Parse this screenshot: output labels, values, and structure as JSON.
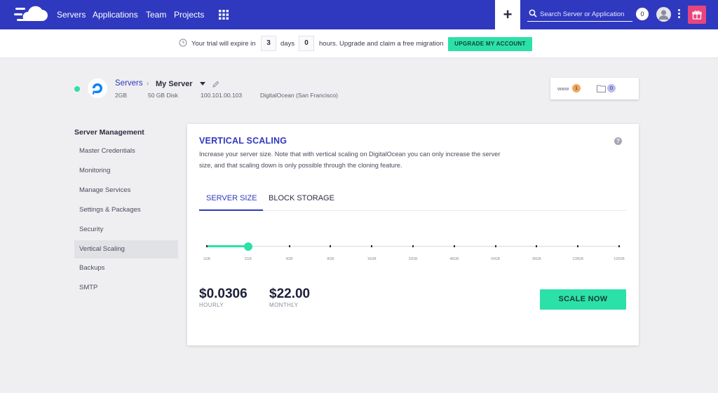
{
  "nav": {
    "items": [
      "Servers",
      "Applications",
      "Team",
      "Projects"
    ],
    "plus_label": "+",
    "search_placeholder": "Search Server or Application",
    "notification_count": "0"
  },
  "trial": {
    "text_before": "Your trial will expire in",
    "days_value": "3",
    "days_label": "days",
    "hours_value": "0",
    "hours_text": "hours. Upgrade and claim a free migration",
    "upgrade_label": "UPGRADE MY ACCOUNT"
  },
  "server": {
    "breadcrumb_root": "Servers",
    "breadcrumb_sep": "›",
    "name": "My Server",
    "ram": "2GB",
    "disk": "50 GB Disk",
    "ip": "100.101.00.103",
    "provider": "DigitalOcean (San Francisco)",
    "www_label": "www",
    "www_count": "1",
    "files_count": "0"
  },
  "sidebar": {
    "title": "Server Management",
    "items": [
      {
        "label": "Master Credentials"
      },
      {
        "label": "Monitoring"
      },
      {
        "label": "Manage Services"
      },
      {
        "label": "Settings & Packages"
      },
      {
        "label": "Security"
      },
      {
        "label": "Vertical Scaling"
      },
      {
        "label": "Backups"
      },
      {
        "label": "SMTP"
      }
    ],
    "active_item": "Vertical Scaling"
  },
  "scaling": {
    "title": "VERTICAL SCALING",
    "help_label": "?",
    "description": "Increase your server size. Note that with vertical scaling on DigitalOcean you can only increase the server size, and that scaling down is only possible through the cloning feature.",
    "tabs": [
      "SERVER SIZE",
      "BLOCK STORAGE"
    ],
    "active_tab": "SERVER SIZE",
    "sizes": [
      "1GB",
      "2GB",
      "4GB",
      "8GB",
      "16GB",
      "32GB",
      "48GB",
      "64GB",
      "96GB",
      "128GB",
      "192GB"
    ],
    "selected_size": "2GB",
    "hourly_price": "$0.0306",
    "hourly_label": "HOURLY",
    "monthly_price": "$22.00",
    "monthly_label": "MONTHLY",
    "scale_button": "SCALE NOW"
  },
  "colors": {
    "nav_bg": "#2f39bf",
    "accent_green": "#2be1a8",
    "gift_pink": "#e8457f",
    "www_badge": "#f2a65a",
    "files_badge": "#b9bdf0"
  },
  "icons": [
    "logo-cloud-icon",
    "apps-grid-icon",
    "search-icon",
    "user-icon",
    "kebab-menu-icon",
    "gift-icon",
    "clock-icon",
    "digitalocean-logo-icon",
    "pencil-icon",
    "folder-icon",
    "help-icon"
  ]
}
